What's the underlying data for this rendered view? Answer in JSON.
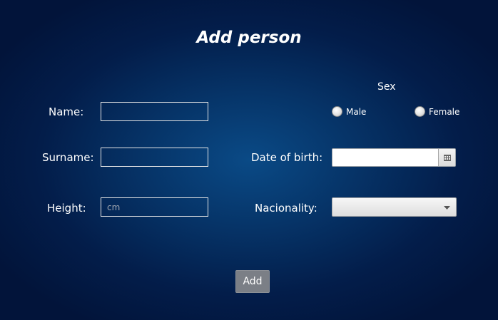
{
  "title": "Add person",
  "form": {
    "name_label": "Name:",
    "name_value": "",
    "surname_label": "Surname:",
    "surname_value": "",
    "height_label": "Height:",
    "height_value": "",
    "height_placeholder": "cm",
    "sex_label": "Sex",
    "sex_options": [
      "Male",
      "Female"
    ],
    "dob_label": "Date of birth:",
    "dob_value": "",
    "nationality_label": "Nacionality:",
    "nationality_value": ""
  },
  "actions": {
    "add_label": "Add"
  },
  "icons": {
    "calendar": "calendar-icon",
    "dropdown": "chevron-down-icon"
  },
  "colors": {
    "button_bg": "#7b7f86",
    "background_center": "#0a4a86",
    "background_edge": "#02143a"
  }
}
